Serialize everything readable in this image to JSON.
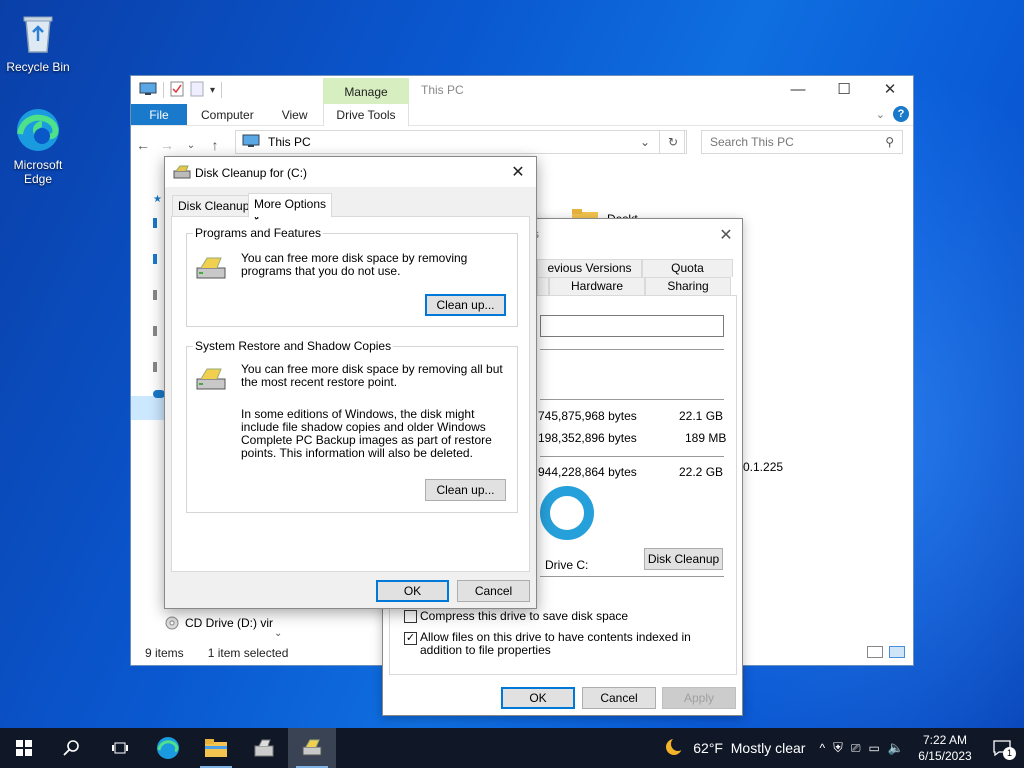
{
  "desktop": {
    "icons": [
      {
        "label": "Recycle Bin"
      },
      {
        "label": "Microsoft Edge"
      }
    ]
  },
  "explorer": {
    "title": "This PC",
    "manage_tab": "Manage",
    "drive_tools_tab": "Drive Tools",
    "ribbon_tabs": [
      "File",
      "Computer",
      "View"
    ],
    "address": "This PC",
    "search_placeholder": "Search This PC",
    "status_items": "9 items",
    "status_selected": "1 item selected",
    "cd_drive": "CD Drive (D:) vir",
    "desktop_folder": "Deskt",
    "version_text": "0.1.225"
  },
  "properties": {
    "tabs_row1": [
      "evious Versions",
      "Quota"
    ],
    "tabs_row2": [
      "Hardware",
      "Sharing"
    ],
    "used_bytes": "745,875,968 bytes",
    "used_gb": "22.1 GB",
    "free_bytes": "198,352,896 bytes",
    "free_mb": "189 MB",
    "capacity_bytes": "944,228,864 bytes",
    "capacity_gb": "22.2 GB",
    "drive_label": "Drive C:",
    "disk_cleanup_btn": "Disk Cleanup",
    "compress_label": "Compress this drive to save disk space",
    "index_label": "Allow files on this drive to have contents indexed in addition to file properties",
    "ok": "OK",
    "cancel": "Cancel",
    "apply": "Apply",
    "title_fragment": "s"
  },
  "disk_cleanup": {
    "title": "Disk Cleanup for  (C:)",
    "tabs": [
      "Disk Cleanup",
      "More Options"
    ],
    "programs_group": "Programs and Features",
    "programs_text": "You can free more disk space by removing programs that you do not use.",
    "programs_btn": "Clean up...",
    "restore_group": "System Restore and Shadow Copies",
    "restore_text": "You can free more disk space by removing all but the most recent restore point.",
    "restore_text2": "In some editions of Windows, the disk might include file shadow copies and older Windows Complete PC Backup images as part of restore points. This information will also be deleted.",
    "restore_btn": "Clean up...",
    "ok": "OK",
    "cancel": "Cancel"
  },
  "taskbar": {
    "weather": "62°F  Mostly clear",
    "time": "7:22 AM",
    "date": "6/15/2023",
    "notifications": "1"
  },
  "colors": {
    "accent": "#0078d7",
    "file_tab": "#1979ca",
    "manage_tab": "#d7efc0",
    "taskbar": "#101828",
    "donut": "#26a0da"
  }
}
